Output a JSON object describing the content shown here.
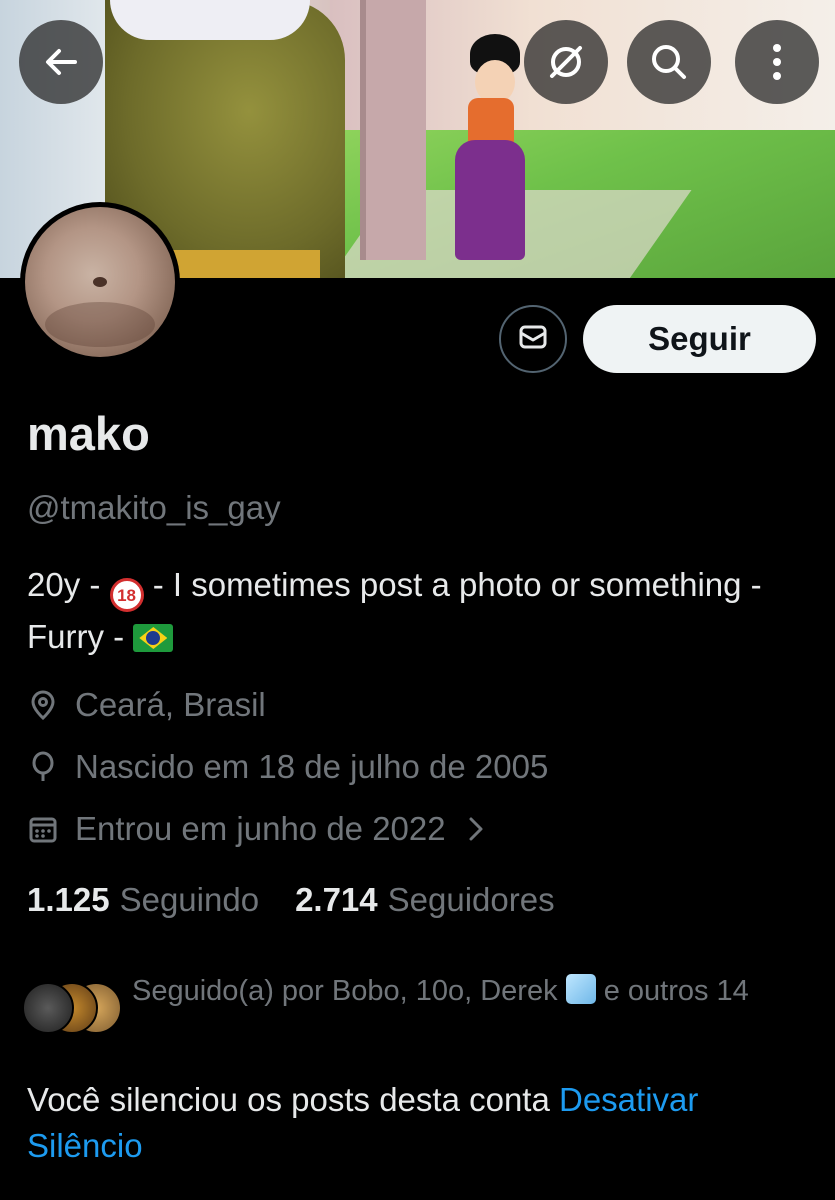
{
  "header": {
    "back_icon": "arrow-left-icon",
    "grok_icon": "grok-icon",
    "search_icon": "search-icon",
    "more_icon": "more-vertical-icon"
  },
  "profile": {
    "display_name": "mako",
    "handle": "@tmakito_is_gay",
    "bio_prefix": "20y - ",
    "bio_badge": "18",
    "bio_mid": " - I sometimes post a photo or something - Furry - ",
    "location": "Ceará, Brasil",
    "birthday": "Nascido em 18 de julho de 2005",
    "joined": "Entrou em junho de 2022"
  },
  "actions": {
    "follow_label": "Seguir"
  },
  "stats": {
    "following_count": "1.125",
    "following_label": "Seguindo",
    "followers_count": "2.714",
    "followers_label": "Seguidores"
  },
  "followed_by": {
    "text_before": "Seguido(a) por Bobo, 10o, Derek ",
    "text_after": " e outros 14"
  },
  "muted_notice": {
    "text": "Você silenciou os posts desta conta ",
    "link": "Desativar Silêncio"
  },
  "colors": {
    "background": "#000000",
    "secondary_text": "#71767b",
    "link": "#1d9bf0"
  }
}
